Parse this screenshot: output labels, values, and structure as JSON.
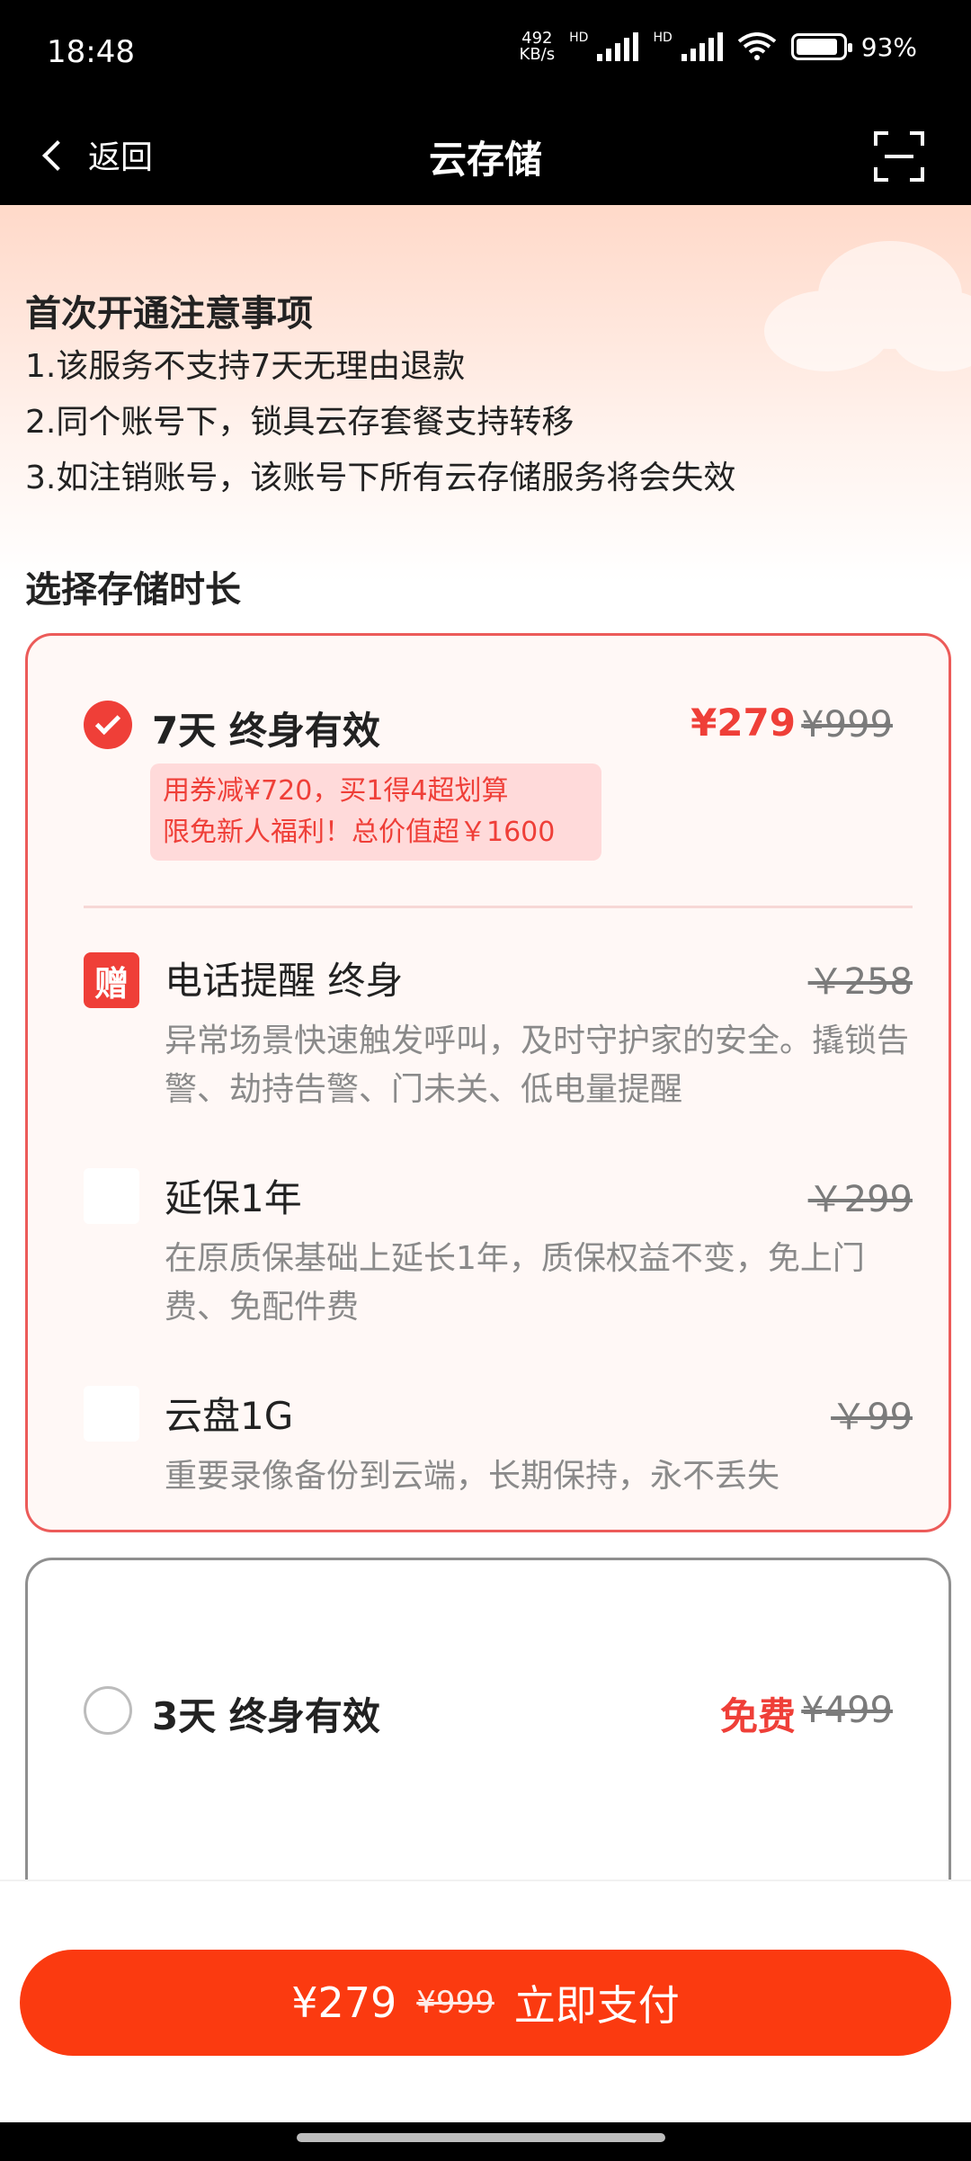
{
  "status": {
    "time": "18:48",
    "net_speed_top": "492",
    "net_speed_bottom": "KB/s",
    "hd": "HD",
    "battery": "93%"
  },
  "nav": {
    "back_label": "返回",
    "title": "云存储"
  },
  "notice": {
    "title": "首次开通注意事项",
    "lines": [
      "1.该服务不支持7天无理由退款",
      "2.同个账号下，锁具云存套餐支持转移",
      "3.如注销账号，该账号下所有云存储服务将会失效"
    ]
  },
  "section_title": "选择存储时长",
  "plan_selected": {
    "title": "7天 终身有效",
    "price": "¥279",
    "old_price": "¥999",
    "promo_line1": "用券减¥720，买1得4超划算",
    "promo_line2": "限免新人福利！总价值超￥1600",
    "gift_badge": "赠",
    "items": [
      {
        "title": "电话提醒 终身",
        "price": "￥258",
        "desc": "异常场景快速触发呼叫，及时守护家的安全。撬锁告警、劫持告警、门未关、低电量提醒"
      },
      {
        "title": "延保1年",
        "price": "￥299",
        "desc": "在原质保基础上延长1年，质保权益不变，免上门费、免配件费"
      },
      {
        "title": "云盘1G",
        "price": "￥99",
        "desc": "重要录像备份到云端，长期保持，永不丢失"
      }
    ]
  },
  "plan_other": {
    "title": "3天 终身有效",
    "price": "免费",
    "old_price": "¥499"
  },
  "pay": {
    "price": "¥279",
    "old_price": "¥999",
    "label": "立即支付"
  },
  "colors": {
    "accent": "#ef3f38",
    "button": "#fb3a10"
  }
}
